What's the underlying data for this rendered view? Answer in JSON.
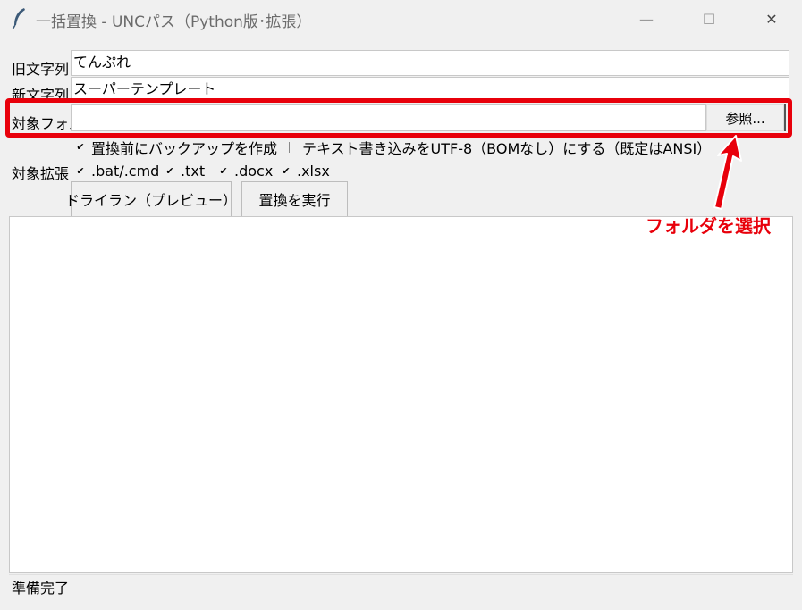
{
  "window": {
    "title": "一括置換 - UNCパス（Python版･拡張）",
    "minimize_glyph": "—",
    "maximize_glyph": "☐",
    "close_glyph": "✕"
  },
  "form": {
    "old_label": "旧文字列",
    "old_value": "てんぷれ",
    "new_label": "新文字列",
    "new_value": "スーパーテンプレート",
    "folder_label": "対象フォル",
    "folder_value": "",
    "browse_label": "参照...",
    "ext_label": "対象拡張"
  },
  "options": {
    "backup_label": "置換前にバックアップを作成",
    "backup_checked": true,
    "utf8_label": "テキスト書き込みをUTF-8（BOMなし）にする（既定はANSI）",
    "utf8_checked": false
  },
  "extensions": [
    {
      "label": ".bat/.cmd",
      "checked": true
    },
    {
      "label": ".txt",
      "checked": true
    },
    {
      "label": ".docx",
      "checked": true
    },
    {
      "label": ".xlsx",
      "checked": true
    }
  ],
  "buttons": {
    "dryrun": "ドライラン（プレビュー）",
    "execute": "置換を実行"
  },
  "status": "準備完了",
  "annotation": {
    "text": "フォルダを選択",
    "color": "#e8000b"
  }
}
